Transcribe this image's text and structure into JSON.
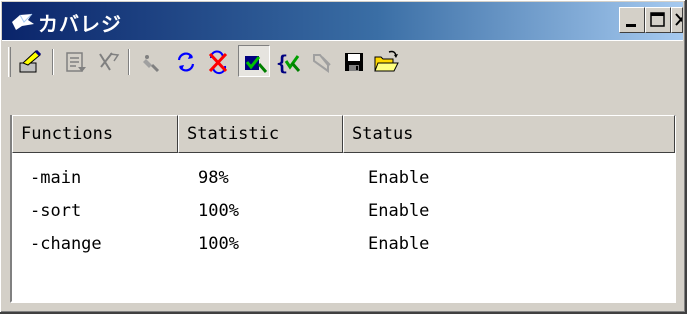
{
  "window": {
    "title": "カバレジ",
    "minimize_label": "Minimize",
    "maximize_label": "Maximize",
    "close_label": "Close"
  },
  "toolbar": {
    "buttons": [
      {
        "icon": "brush-tool-icon",
        "enabled": true
      },
      {
        "icon": "document-properties-icon",
        "enabled": false
      },
      {
        "icon": "delete-icon",
        "enabled": false
      },
      {
        "icon": "satellite-icon",
        "enabled": false
      },
      {
        "icon": "refresh-icon",
        "enabled": true
      },
      {
        "icon": "clear-icon",
        "enabled": true
      },
      {
        "icon": "flag-enable-icon",
        "enabled": true,
        "pressed": true
      },
      {
        "icon": "function-enable-icon",
        "enabled": true
      },
      {
        "icon": "function-disabled-icon",
        "enabled": false
      },
      {
        "icon": "save-icon",
        "enabled": true
      },
      {
        "icon": "open-folder-icon",
        "enabled": true
      }
    ]
  },
  "table": {
    "headers": [
      "Functions",
      "Statistic",
      "Status"
    ],
    "rows": [
      {
        "function": "-main",
        "statistic": "98%",
        "status": "Enable"
      },
      {
        "function": "-sort",
        "statistic": "100%",
        "status": "Enable"
      },
      {
        "function": "-change",
        "statistic": "100%",
        "status": "Enable"
      }
    ]
  }
}
